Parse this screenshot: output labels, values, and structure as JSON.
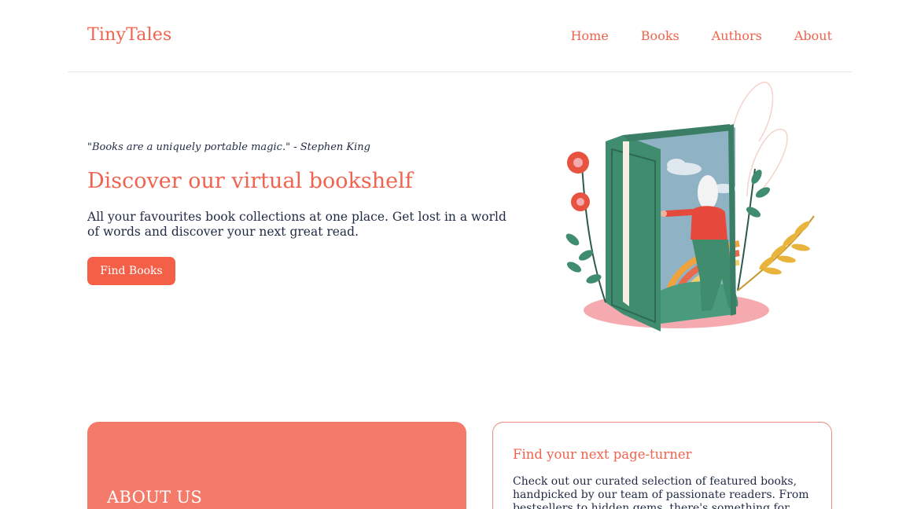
{
  "header": {
    "logo": "TinyTales",
    "nav": [
      "Home",
      "Books",
      "Authors",
      "About"
    ]
  },
  "hero": {
    "quote": "\"Books are a uniquely portable magic.\" - Stephen King",
    "title": "Discover our virtual bookshelf",
    "text": "All your favourites book collections at one place. Get lost in a world of words and discover your next great read.",
    "button": "Find Books"
  },
  "about_card": {
    "title": "ABOUT US"
  },
  "find_card": {
    "title": "Find your next page-turner",
    "text": "Check out our curated selection of featured books, handpicked by our team of passionate readers. From bestsellers to hidden gems, there's something for"
  },
  "colors": {
    "accent": "#f0634e",
    "button": "#f45f48",
    "about_bg": "#f47a6a",
    "text": "#1f2a44"
  }
}
